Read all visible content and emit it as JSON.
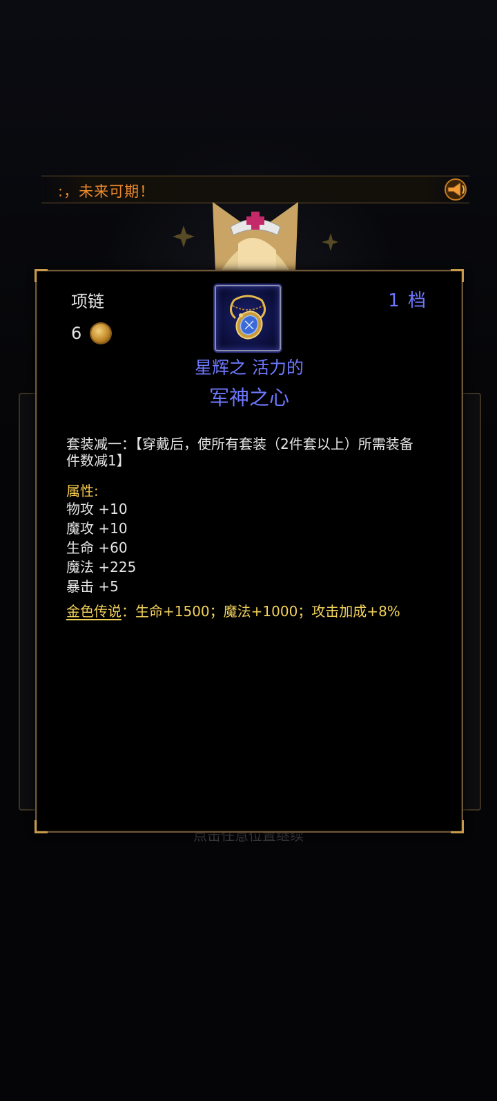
{
  "marquee": {
    "text": ":，未来可期！",
    "icon": "megaphone-icon"
  },
  "background": {
    "hint_text": "点击任意位置继续"
  },
  "item": {
    "slot_type": "项链",
    "cost_value": "6",
    "cost_icon": "gold-coin-icon",
    "grade": "1 档",
    "icon": "necklace-icon",
    "prefix": "星辉之 活力的",
    "name": "军神之心",
    "set_description": "套装减一：【穿戴后，使所有套装（2件套以上）所需装备件数减1】",
    "attributes_title": "属性:",
    "attributes": [
      "物攻 +10",
      "魔攻 +10",
      "生命 +60",
      "魔法 +225",
      "暴击 +5"
    ],
    "legend_label": "金色传说",
    "legend_effects": "：生命+1500；魔法+1000；攻击加成+8%"
  },
  "colors": {
    "accent_blue": "#6e78ff",
    "gold_text": "#f2c84a",
    "marquee_orange": "#f08a2c",
    "frame_bronze": "#6e5636"
  }
}
